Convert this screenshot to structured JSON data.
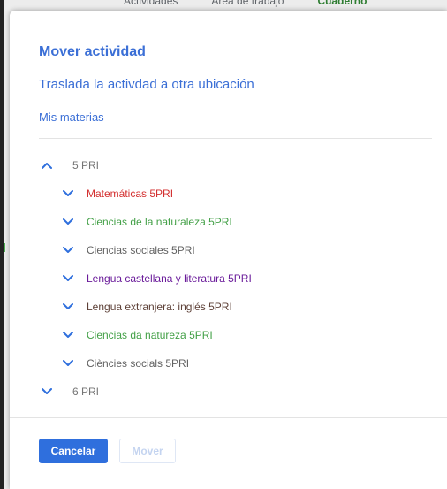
{
  "background": {
    "tabs": [
      "Actividades",
      "Área de trabajo",
      "Cuaderno"
    ]
  },
  "dialog": {
    "title": "Mover actividad",
    "subtitle": "Traslada la activdad a otra ubicación",
    "breadcrumb": "Mis materias",
    "tree": [
      {
        "label": "5 PRI",
        "level": 0,
        "expanded": true,
        "color": "#757575"
      },
      {
        "label": "Matemáticas 5PRI",
        "level": 1,
        "expanded": false,
        "color": "#d32f2f"
      },
      {
        "label": "Ciencias de la naturaleza 5PRI",
        "level": 1,
        "expanded": false,
        "color": "#43a047"
      },
      {
        "label": "Ciencias sociales 5PRI",
        "level": 1,
        "expanded": false,
        "color": "#616161"
      },
      {
        "label": "Lengua castellana y literatura 5PRI",
        "level": 1,
        "expanded": false,
        "color": "#6a1b9a"
      },
      {
        "label": "Lengua extranjera: inglés 5PRI",
        "level": 1,
        "expanded": false,
        "color": "#5d4037"
      },
      {
        "label": "Ciencias da natureza 5PRI",
        "level": 1,
        "expanded": false,
        "color": "#43a047"
      },
      {
        "label": "Ciències socials 5PRI",
        "level": 1,
        "expanded": false,
        "color": "#616161"
      },
      {
        "label": "6 PRI",
        "level": 0,
        "expanded": false,
        "color": "#757575"
      }
    ],
    "cancel_label": "Cancelar",
    "move_label": "Mover"
  },
  "colors": {
    "accent": "#3b6fd6",
    "primary_button": "#2f6fdd"
  }
}
